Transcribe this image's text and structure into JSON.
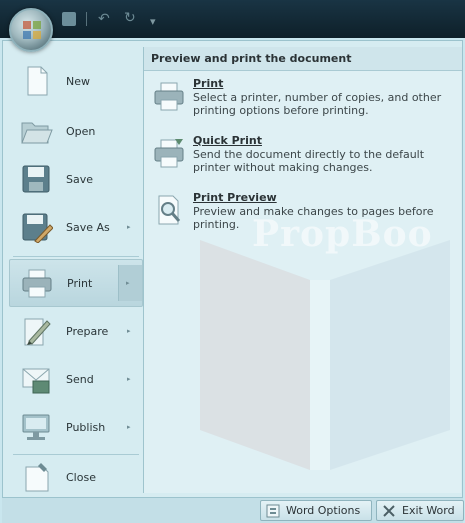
{
  "menu": {
    "items": [
      {
        "label": "New",
        "has_submenu": false,
        "icon": "new-document-icon"
      },
      {
        "label": "Open",
        "has_submenu": false,
        "icon": "open-folder-icon"
      },
      {
        "label": "Save",
        "has_submenu": false,
        "icon": "save-icon"
      },
      {
        "label": "Save As",
        "has_submenu": true,
        "icon": "save-as-icon"
      },
      {
        "label": "Print",
        "has_submenu": true,
        "icon": "printer-icon",
        "active": true
      },
      {
        "label": "Prepare",
        "has_submenu": true,
        "icon": "prepare-icon"
      },
      {
        "label": "Send",
        "has_submenu": true,
        "icon": "send-icon"
      },
      {
        "label": "Publish",
        "has_submenu": true,
        "icon": "publish-icon"
      },
      {
        "label": "Close",
        "has_submenu": false,
        "icon": "close-document-icon"
      }
    ],
    "arrow": "▸"
  },
  "submenu": {
    "heading": "Preview and print the document",
    "items": [
      {
        "title": "Print",
        "description": "Select a printer, number of copies, and other printing options before printing.",
        "icon": "printer-icon"
      },
      {
        "title": "Quick Print",
        "description": "Send the document directly to the default printer without making changes.",
        "icon": "quick-print-icon"
      },
      {
        "title": "Print Preview",
        "description": "Preview and make changes to pages before printing.",
        "icon": "print-preview-icon"
      }
    ]
  },
  "footer": {
    "options_label": "Word Options",
    "exit_label": "Exit Word"
  },
  "watermark": {
    "text": "PropBoo"
  }
}
